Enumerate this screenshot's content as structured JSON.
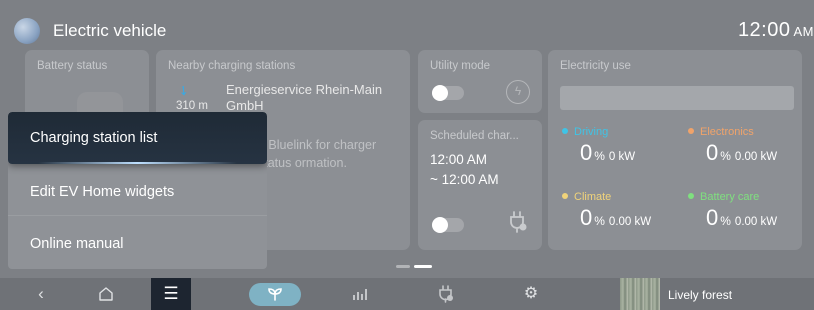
{
  "header": {
    "title": "Electric vehicle",
    "time": "12:00",
    "ampm": "AM"
  },
  "widgets": {
    "battery": {
      "title": "Battery status"
    },
    "nearby": {
      "title": "Nearby charging stations",
      "distance": "310 m",
      "station_name": "Energieservice Rhein-Main GmbH",
      "message": "e Bluelink for charger status ormation."
    },
    "utility": {
      "title": "Utility mode"
    },
    "scheduled": {
      "title": "Scheduled char...",
      "time_start": "12:00 AM",
      "time_end": "~ 12:00 AM"
    },
    "electricity": {
      "title": "Electricity use",
      "metrics": [
        {
          "label": "Driving",
          "value": "0",
          "unit": "%",
          "kw": "0 kW",
          "color": "#3fc4e6"
        },
        {
          "label": "Electronics",
          "value": "0",
          "unit": "%",
          "kw": "0.00 kW",
          "color": "#f0a36a"
        },
        {
          "label": "Climate",
          "value": "0",
          "unit": "%",
          "kw": "0.00 kW",
          "color": "#f0d37a"
        },
        {
          "label": "Battery care",
          "value": "0",
          "unit": "%",
          "kw": "0.00 kW",
          "color": "#7fe07f"
        }
      ]
    }
  },
  "popup_menu": {
    "items": [
      {
        "label": "Charging station list"
      },
      {
        "label": "Edit EV Home widgets"
      },
      {
        "label": "Online manual"
      }
    ]
  },
  "bottom_bar": {
    "back_icon": "back-chevron-icon",
    "home_icon": "home-icon",
    "menu_icon": "menu-icon",
    "media_title": "Lively forest"
  }
}
